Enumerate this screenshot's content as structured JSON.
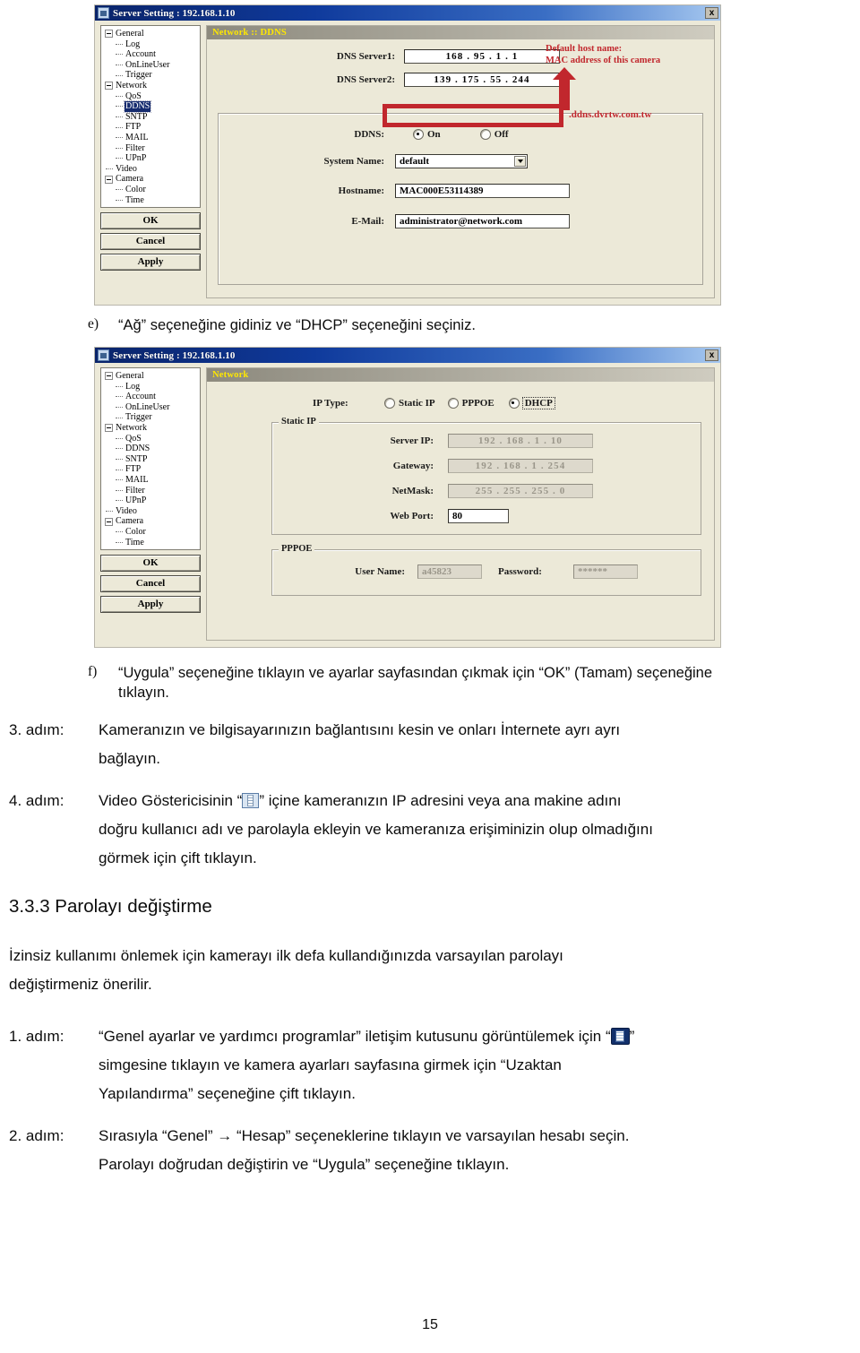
{
  "page": {
    "number": "15"
  },
  "dialog_ddns": {
    "titlebar": {
      "title": "Server Setting : 192.168.1.10",
      "close_label": "x",
      "icon": "app-icon"
    },
    "page_header": "Network :: DDNS",
    "tree": [
      {
        "label": "General",
        "level": 0,
        "expander": true,
        "selected": false
      },
      {
        "label": "Log",
        "level": 1,
        "expander": false,
        "selected": false
      },
      {
        "label": "Account",
        "level": 1,
        "expander": false,
        "selected": false
      },
      {
        "label": "OnLineUser",
        "level": 1,
        "expander": false,
        "selected": false
      },
      {
        "label": "Trigger",
        "level": 1,
        "expander": false,
        "selected": false
      },
      {
        "label": "Network",
        "level": 0,
        "expander": true,
        "selected": false
      },
      {
        "label": "QoS",
        "level": 1,
        "expander": false,
        "selected": false
      },
      {
        "label": "DDNS",
        "level": 1,
        "expander": false,
        "selected": true
      },
      {
        "label": "SNTP",
        "level": 1,
        "expander": false,
        "selected": false
      },
      {
        "label": "FTP",
        "level": 1,
        "expander": false,
        "selected": false
      },
      {
        "label": "MAIL",
        "level": 1,
        "expander": false,
        "selected": false
      },
      {
        "label": "Filter",
        "level": 1,
        "expander": false,
        "selected": false
      },
      {
        "label": "UPnP",
        "level": 1,
        "expander": false,
        "selected": false
      },
      {
        "label": "Video",
        "level": 0,
        "expander": false,
        "selected": false
      },
      {
        "label": "Camera",
        "level": 0,
        "expander": true,
        "selected": false
      },
      {
        "label": "Color",
        "level": 1,
        "expander": false,
        "selected": false
      },
      {
        "label": "Time",
        "level": 1,
        "expander": false,
        "selected": false
      }
    ],
    "buttons": {
      "ok": "OK",
      "cancel": "Cancel",
      "apply": "Apply"
    },
    "fields": {
      "dns1_label": "DNS Server1:",
      "dns1_value": "168 . 95 . 1 . 1",
      "dns2_label": "DNS Server2:",
      "dns2_value": "139 . 175 . 55 . 244",
      "ddns_label": "DDNS:",
      "ddns_on": "On",
      "ddns_off": "Off",
      "ddns_selected": "On",
      "sysname_label": "System Name:",
      "sysname_value": "default",
      "hostname_label": "Hostname:",
      "hostname_value": "MAC000E53114389",
      "hostname_suffix": ".ddns.dvrtw.com.tw",
      "email_label": "E-Mail:",
      "email_value": "administrator@network.com"
    },
    "annotation": {
      "line1": "Default host name:",
      "line2": "MAC address of this camera",
      "color": "#c1272d"
    }
  },
  "dialog_network": {
    "titlebar": {
      "title": "Server Setting : 192.168.1.10",
      "close_label": "x",
      "icon": "app-icon"
    },
    "page_header": "Network",
    "tree": [
      {
        "label": "General",
        "level": 0,
        "expander": true,
        "selected": false
      },
      {
        "label": "Log",
        "level": 1,
        "expander": false,
        "selected": false
      },
      {
        "label": "Account",
        "level": 1,
        "expander": false,
        "selected": false
      },
      {
        "label": "OnLineUser",
        "level": 1,
        "expander": false,
        "selected": false
      },
      {
        "label": "Trigger",
        "level": 1,
        "expander": false,
        "selected": false
      },
      {
        "label": "Network",
        "level": 0,
        "expander": true,
        "selected": false
      },
      {
        "label": "QoS",
        "level": 1,
        "expander": false,
        "selected": false
      },
      {
        "label": "DDNS",
        "level": 1,
        "expander": false,
        "selected": false
      },
      {
        "label": "SNTP",
        "level": 1,
        "expander": false,
        "selected": false
      },
      {
        "label": "FTP",
        "level": 1,
        "expander": false,
        "selected": false
      },
      {
        "label": "MAIL",
        "level": 1,
        "expander": false,
        "selected": false
      },
      {
        "label": "Filter",
        "level": 1,
        "expander": false,
        "selected": false
      },
      {
        "label": "UPnP",
        "level": 1,
        "expander": false,
        "selected": false
      },
      {
        "label": "Video",
        "level": 0,
        "expander": false,
        "selected": false
      },
      {
        "label": "Camera",
        "level": 0,
        "expander": true,
        "selected": false
      },
      {
        "label": "Color",
        "level": 1,
        "expander": false,
        "selected": false
      },
      {
        "label": "Time",
        "level": 1,
        "expander": false,
        "selected": false
      }
    ],
    "buttons": {
      "ok": "OK",
      "cancel": "Cancel",
      "apply": "Apply"
    },
    "fields": {
      "iptype_label": "IP Type:",
      "iptype_static": "Static IP",
      "iptype_pppoe": "PPPOE",
      "iptype_dhcp": "DHCP",
      "iptype_selected": "DHCP",
      "static_group": "Static IP",
      "serverip_label": "Server IP:",
      "serverip_value": "192 . 168 . 1 . 10",
      "gateway_label": "Gateway:",
      "gateway_value": "192 . 168 . 1 . 254",
      "netmask_label": "NetMask:",
      "netmask_value": "255 . 255 . 255 . 0",
      "webport_label": "Web Port:",
      "webport_value": "80",
      "pppoe_group": "PPPOE",
      "username_label": "User Name:",
      "username_value": "a45823",
      "password_label": "Password:",
      "password_value": "******"
    }
  },
  "text": {
    "item_e_marker": "e)",
    "item_e": "“Ağ” seçeneğine gidiniz ve “DHCP” seçeneğini seçiniz.",
    "item_f_marker": "f)",
    "item_f_line1": "“Uygula” seçeneğine tıklayın ve ayarlar sayfasından çıkmak için “OK” (Tamam) seçeneğine",
    "item_f_line2": "tıklayın.",
    "step3_marker": "3. adım:",
    "step3_line1": "Kameranızın ve bilgisayarınızın bağlantısını kesin ve onları İnternete ayrı ayrı",
    "step3_line2": "bağlayın.",
    "step4_marker": "4. adım:",
    "step4_line1a": "Video Göstericisinin “",
    "step4_line1b": "” içine kameranızın IP adresini veya ana makine adını",
    "step4_line2": "doğru kullanıcı adı ve parolayla ekleyin ve kameranıza erişiminizin olup olmadığını",
    "step4_line3": "görmek için çift tıklayın.",
    "heading_333": "3.3.3 Parolayı değiştirme",
    "intro_line1": "İzinsiz kullanımı önlemek için kamerayı ilk defa kullandığınızda varsayılan parolayı",
    "intro_line2": "değiştirmeniz önerilir.",
    "step1_marker": "1. adım:",
    "step1_line1a": "“Genel ayarlar ve yardımcı programlar” iletişim kutusunu görüntülemek için “",
    "step1_line1b": "”",
    "step1_line2": "simgesine tıklayın ve kamera ayarları sayfasına girmek için “Uzaktan",
    "step1_line3": "Yapılandırma” seçeneğine çift tıklayın.",
    "step2_marker": "2. adım:",
    "step2_line1": "Sırasıyla “Genel” → “Hesap” seçeneklerine tıklayın ve varsayılan hesabı seçin.",
    "step2_line2": "Parolayı doğrudan değiştirin ve “Uygula” seçeneğine tıklayın."
  }
}
